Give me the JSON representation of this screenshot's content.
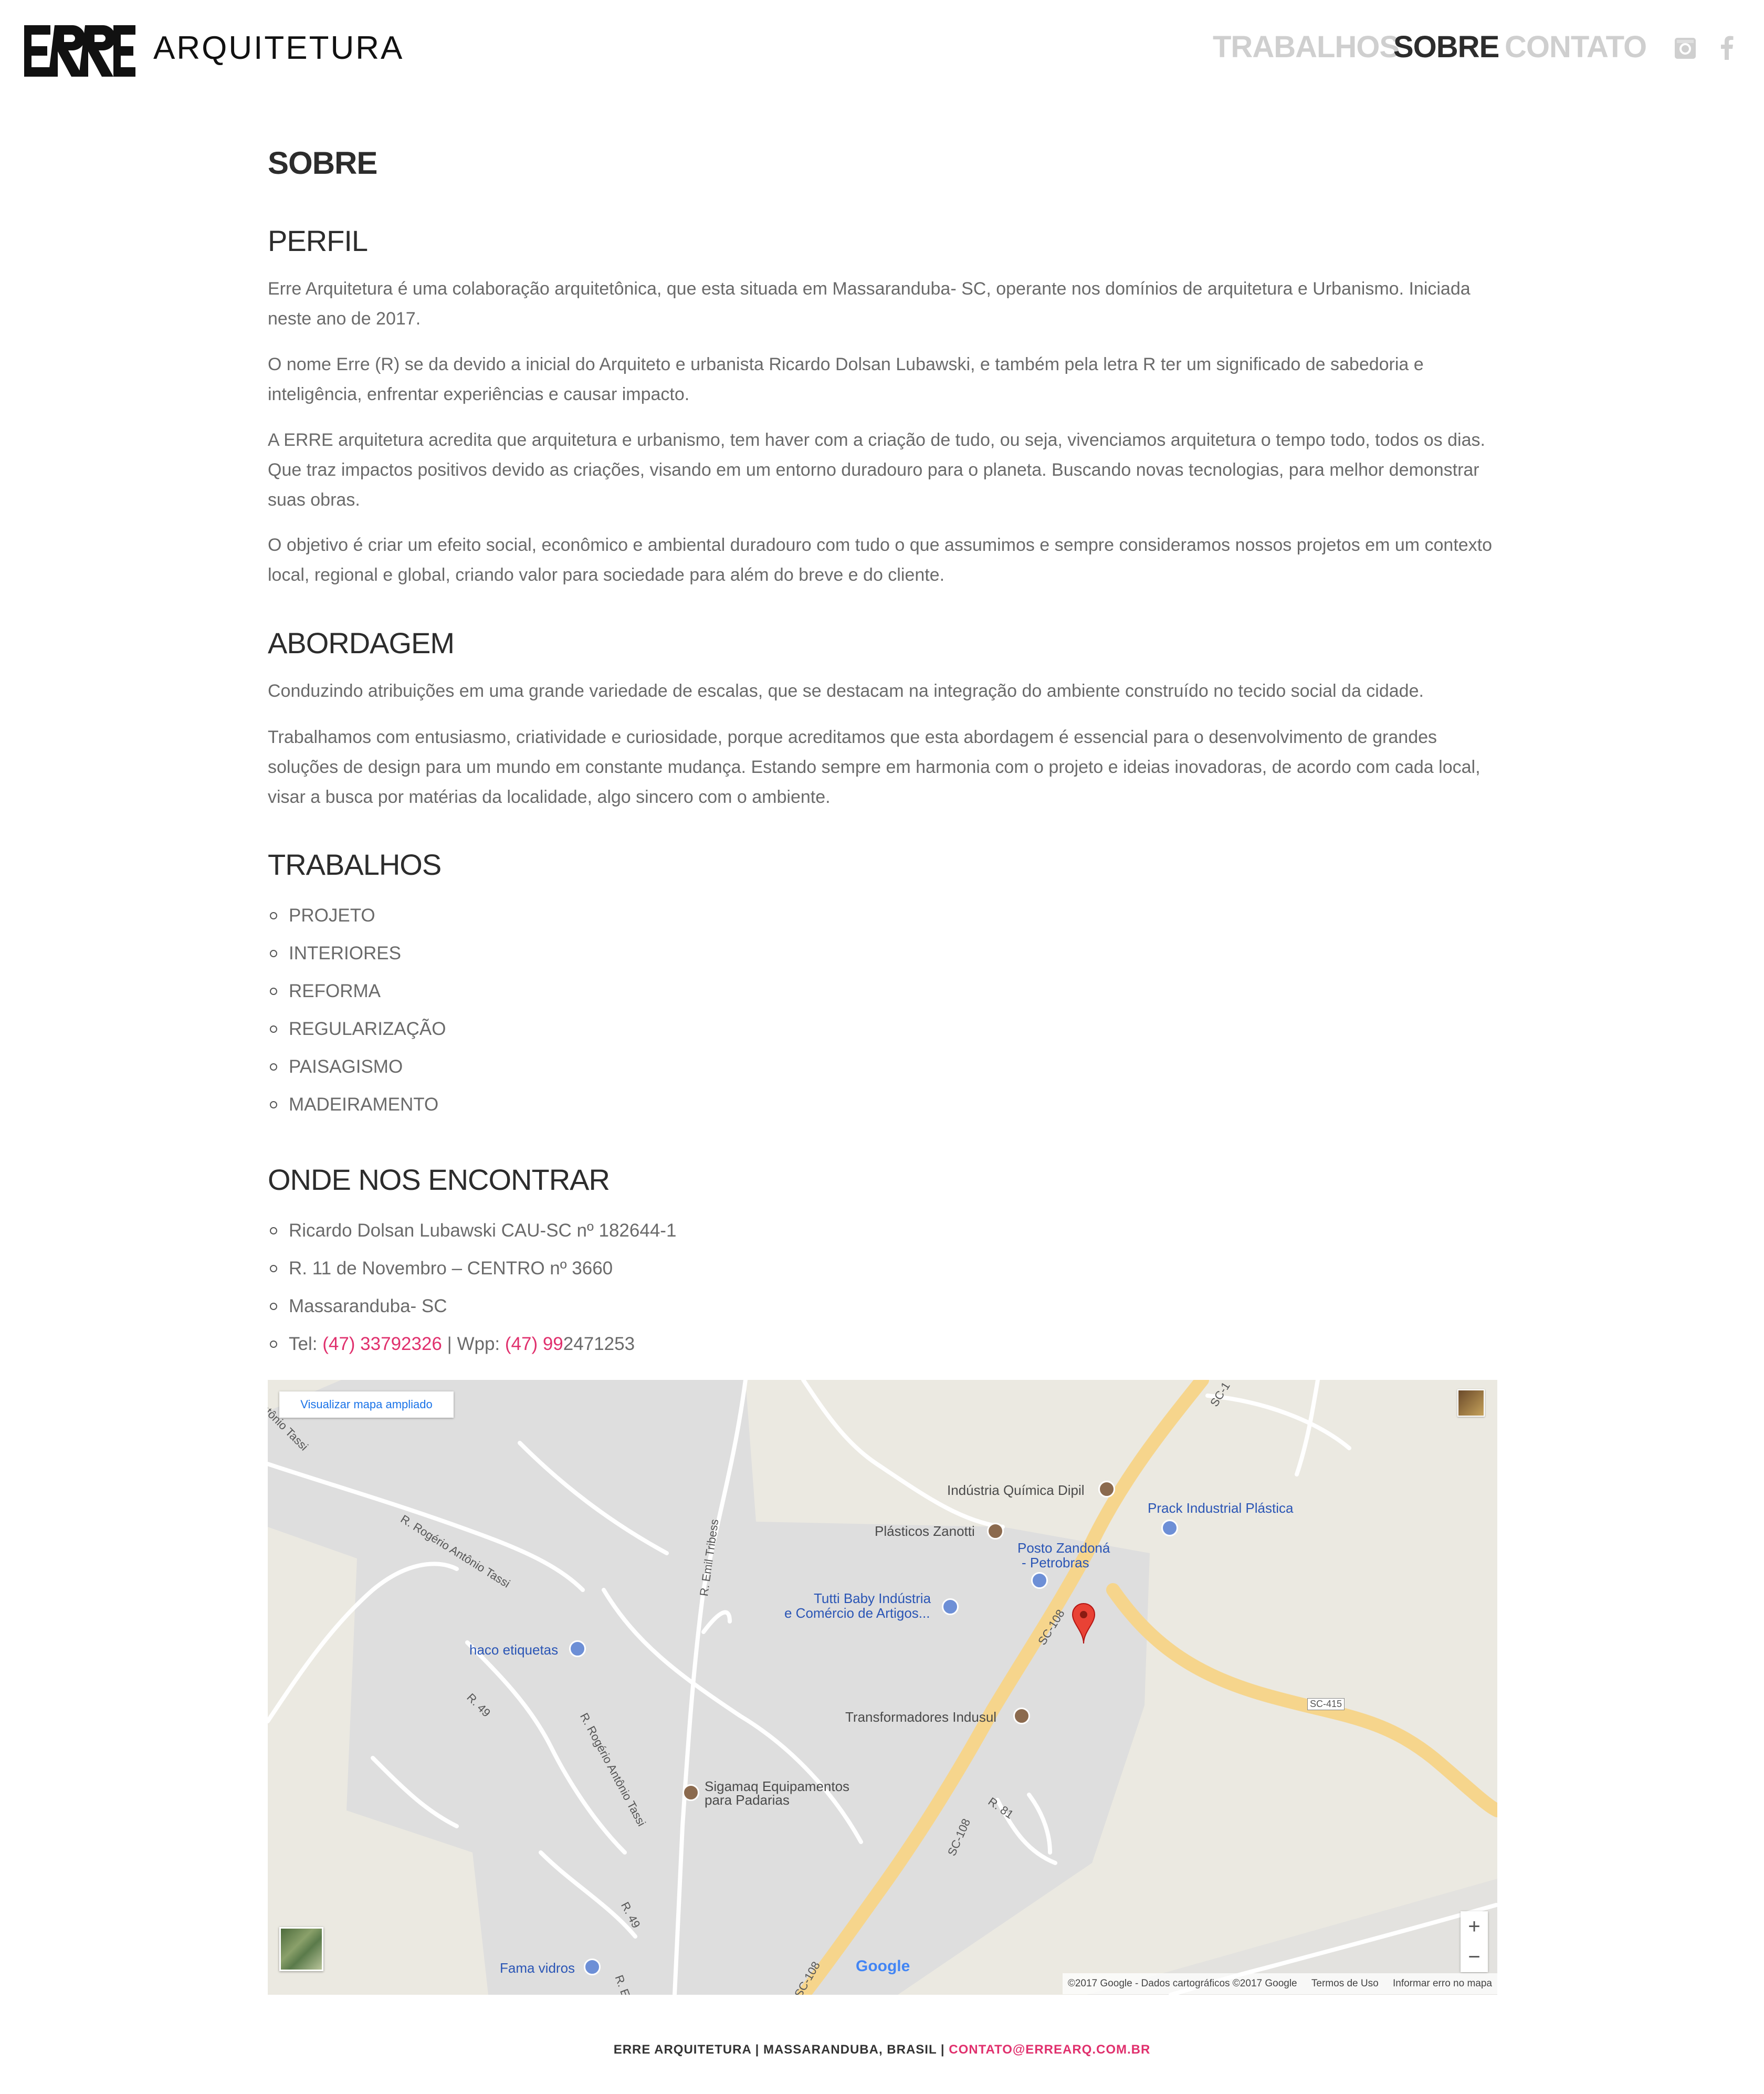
{
  "brand": {
    "logo_text": "ARQUITETURA",
    "logo_mark_text": "ERRE"
  },
  "nav": {
    "items": [
      "TRABALHOS",
      "SOBRE",
      "CONTATO"
    ],
    "active": "SOBRE"
  },
  "social": {
    "instagram": "instagram-icon",
    "facebook": "facebook-icon"
  },
  "page": {
    "title": "SOBRE",
    "perfil": {
      "heading": "PERFIL",
      "paragraphs": [
        "Erre Arquitetura é uma colaboração arquitetônica, que esta situada em Massaranduba- SC, operante nos domínios de arquitetura e Urbanismo. Iniciada neste ano de 2017.",
        "O nome Erre (R) se da devido a inicial do Arquiteto e urbanista Ricardo Dolsan Lubawski, e também pela letra R ter um significado de sabedoria e inteligência, enfrentar experiências e causar impacto.",
        "A ERRE arquitetura acredita que arquitetura e urbanismo, tem haver com a criação de tudo, ou seja, vivenciamos arquitetura o tempo todo, todos os dias. Que traz impactos positivos devido as criações, visando em um entorno duradouro para o planeta. Buscando novas tecnologias, para melhor demonstrar suas obras.",
        "O objetivo é criar um efeito social, econômico e ambiental duradouro com tudo o que assumimos e sempre consideramos nossos projetos em um contexto local, regional e global, criando valor para sociedade para além do breve e do cliente."
      ]
    },
    "abordagem": {
      "heading": "ABORDAGEM",
      "paragraphs": [
        "Conduzindo atribuições em uma grande variedade de escalas, que se destacam na integração do ambiente construído no tecido social da cidade.",
        "Trabalhamos com entusiasmo, criatividade e curiosidade, porque acreditamos que esta abordagem é essencial para o desenvolvimento de grandes soluções de design para um mundo em constante mudança. Estando sempre em harmonia com o projeto e ideias inovadoras, de acordo com cada local, visar a busca por matérias da localidade, algo sincero com o ambiente."
      ]
    },
    "trabalhos": {
      "heading": "TRABALHOS",
      "items": [
        "PROJETO",
        "INTERIORES",
        "REFORMA",
        "REGULARIZAÇÃO",
        "PAISAGISMO",
        "MADEIRAMENTO"
      ]
    },
    "onde": {
      "heading": "ONDE NOS ENCONTRAR",
      "items": [
        "Ricardo Dolsan Lubawski  CAU-SC nº 182644-1",
        "R. 11 de Novembro – CENTRO  nº 3660",
        "Massaranduba- SC"
      ],
      "tel_label": "Tel: ",
      "tel_number": "(47) 33792326",
      "wpp_sep": " | Wpp: ",
      "wpp_prefix": "(47) 99",
      "wpp_rest": "2471253"
    }
  },
  "map": {
    "enlarge_button": "Visualizar mapa ampliado",
    "pois": [
      "Indústria Química Dipil",
      "Plásticos Zanotti",
      "Prack Industrial Plástica",
      "Posto Zandoná",
      "- Petrobras",
      "Tutti Baby Indústria",
      "e Comércio de Artigos...",
      "haco etiquetas",
      "Transformadores Indusul",
      "Sigamaq Equipamentos",
      "para Padarias",
      "Fama vidros"
    ],
    "streets": [
      "ntônio Tassi",
      "R. Rogério Antônio Tassi",
      "R. Emil Tribess",
      "R. 49",
      "R. Rogério Antônio Tassi",
      "SC-108",
      "SC-108",
      "SC-108",
      "SC-415",
      "R. 81",
      "R. 49",
      "SC-1",
      "R. E"
    ],
    "google_logo": "Google",
    "attribution": "©2017 Google - Dados cartográficos ©2017 Google",
    "terms": "Termos de Uso",
    "report": "Informar erro no mapa",
    "zoom_in": "+",
    "zoom_out": "−"
  },
  "footer": {
    "text": "ERRE ARQUITETURA | MASSARANDUBA, BRASIL | ",
    "email": "CONTATO@ERREARQ.COM.BR"
  },
  "colors": {
    "accent": "#e0306d",
    "nav_inactive": "#cfcfcf",
    "text": "#6a6a6a",
    "heading": "#2c2c2c"
  }
}
